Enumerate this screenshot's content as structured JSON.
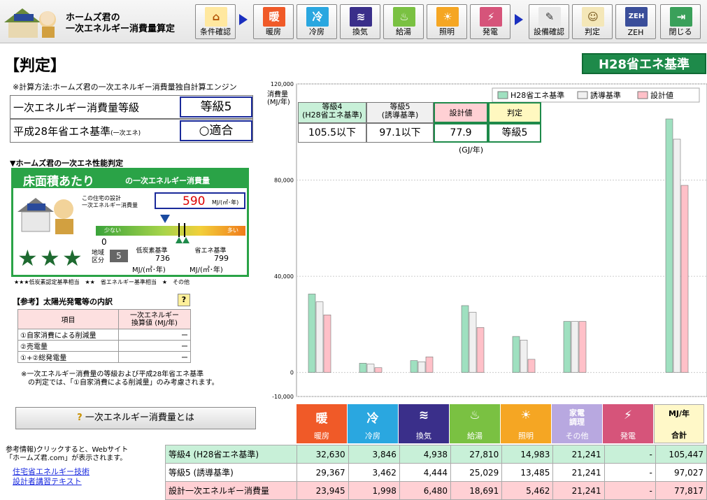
{
  "app": {
    "title_line1": "ホームズ君の",
    "title_line2": "一次エネルギー消費量算定"
  },
  "toolbar": [
    {
      "label": "条件確認",
      "glyph": "⌂",
      "color": "#ffe8a0",
      "fg": "#b05000"
    },
    {
      "label": "暖房",
      "glyph": "暖",
      "color": "#f05a28",
      "fg": "#fff"
    },
    {
      "label": "冷房",
      "glyph": "冷",
      "color": "#2aa7e0",
      "fg": "#fff"
    },
    {
      "label": "換気",
      "glyph": "≋",
      "color": "#3a2f8a",
      "fg": "#fff"
    },
    {
      "label": "給湯",
      "glyph": "♨",
      "color": "#7ac142",
      "fg": "#fff"
    },
    {
      "label": "照明",
      "glyph": "☀",
      "color": "#f5a623",
      "fg": "#fff"
    },
    {
      "label": "発電",
      "glyph": "⚡",
      "color": "#d6547a",
      "fg": "#fff"
    },
    {
      "label": "設備確認",
      "glyph": "✎",
      "color": "#e8e8e8",
      "fg": "#333"
    },
    {
      "label": "判定",
      "glyph": "☺",
      "color": "#f4e7b8",
      "fg": "#6a4a10"
    },
    {
      "label": "ZEH",
      "glyph": "ZEH",
      "color": "#3a4e9a",
      "fg": "#fff"
    },
    {
      "label": "閉じる",
      "glyph": "⇥",
      "color": "#3aa05a",
      "fg": "#fff"
    }
  ],
  "page": {
    "title": "【判定】",
    "standard_badge": "H28省エネ基準"
  },
  "calc_note": "※計算方法:ホームズ君の一次エネルギー消費量独自計算エンジン",
  "grade": {
    "label1": "一次エネルギー消費量等級",
    "value1": "等級5",
    "label2": "平成28年省エネ基準",
    "label2_small": "(一次エネ)",
    "value2": "○適合"
  },
  "perf": {
    "heading": "▼ホームズ君の一次エネ性能判定",
    "banner_main": "床面積あたり",
    "banner_sub": "の一次エネルギー消費量",
    "design_label": "この住宅の設計\n一次エネルギー消費量",
    "design_value": "590",
    "design_unit": "MJ/(㎡･年)",
    "bar_low": "少ない",
    "bar_high": "多い",
    "zero": "0",
    "region_label": "地域\n区分",
    "region_value": "5",
    "low_carbon_label": "低炭素基準",
    "low_carbon_value": "736",
    "saving_label": "省エネ基準",
    "saving_value": "799",
    "unit": "MJ/(㎡･年)",
    "star_legend": "★★★低炭素認定基準相当　★★　省エネルギー基準相当　★　その他"
  },
  "solar": {
    "heading": "【参考】太陽光発電等の内訳",
    "help": "?",
    "col_item": "項目",
    "col_value": "一次エネルギー\n換算値 (MJ/年)",
    "rows": [
      {
        "item": "①自家消費による削減量",
        "value": "ー"
      },
      {
        "item": "②売電量",
        "value": "ー"
      },
      {
        "item": "①+②総発電量",
        "value": "ー"
      }
    ],
    "note": "※一次エネルギー消費量の等級および平成28年省エネ基準\n　の判定では、「①自家消費による削減量」のみ考慮されます。"
  },
  "primary_button": "一次エネルギー消費量とは",
  "reference": {
    "text": "参考情報)クリックすると、Webサイト\n「ホームズ君.com」が表示されます。",
    "link1": "住宅省エネルギー技術",
    "link2": "設計者講習テキスト"
  },
  "summary": {
    "h1": "等級4\n(H28省エネ基準)",
    "v1": "105.5以下",
    "h2": "等級5\n(誘導基準)",
    "v2": "97.1以下",
    "h3": "設計値",
    "v3": "77.9",
    "h4": "判定",
    "v4": "等級5",
    "unit": "(GJ/年)"
  },
  "chart_data": {
    "type": "bar",
    "ylabel": "消費量\n(MJ/年)",
    "ylim": [
      -10000,
      120000
    ],
    "yticks": [
      "120,000",
      "80,000",
      "40,000",
      "0",
      "-10,000"
    ],
    "categories": [
      "暖房",
      "冷房",
      "換気",
      "給湯",
      "照明",
      "その他",
      "発電",
      "合計"
    ],
    "series": [
      {
        "name": "H28省エネ基準",
        "color": "#9fe0c0",
        "values": [
          32630,
          3846,
          4938,
          27810,
          14983,
          21241,
          0,
          105447
        ]
      },
      {
        "name": "誘導基準",
        "color": "#f0f0f0",
        "values": [
          29367,
          3462,
          4444,
          25029,
          13485,
          21241,
          0,
          97027
        ]
      },
      {
        "name": "設計値",
        "color": "#ffc0c8",
        "values": [
          23945,
          1998,
          6480,
          18691,
          5462,
          21241,
          0,
          77817
        ]
      }
    ],
    "legend": "top-right"
  },
  "categories_bar": [
    {
      "glyph": "暖",
      "label": "暖房",
      "color": "#f05a28"
    },
    {
      "glyph": "冷",
      "label": "冷房",
      "color": "#2aa7e0"
    },
    {
      "glyph": "≋",
      "label": "換気",
      "color": "#3a2f8a"
    },
    {
      "glyph": "♨",
      "label": "給湯",
      "color": "#7ac142"
    },
    {
      "glyph": "☀",
      "label": "照明",
      "color": "#f5a623"
    },
    {
      "glyph": "家電\n調理",
      "label": "その他",
      "color": "#b8a8e0"
    },
    {
      "glyph": "⚡",
      "label": "発電",
      "color": "#d6547a"
    },
    {
      "glyph": "MJ/年",
      "label": "合計",
      "color": "#fff8c8"
    }
  ],
  "data_rows": [
    {
      "label": "等級4 (H28省エネ基準)",
      "values": [
        "32,630",
        "3,846",
        "4,938",
        "27,810",
        "14,983",
        "21,241",
        "-",
        "105,447"
      ],
      "color": "#c8f0d8"
    },
    {
      "label": "等級5 (誘導基準)",
      "values": [
        "29,367",
        "3,462",
        "4,444",
        "25,029",
        "13,485",
        "21,241",
        "-",
        "97,027"
      ],
      "color": "#ffffff"
    },
    {
      "label": "設計一次エネルギー消費量",
      "values": [
        "23,945",
        "1,998",
        "6,480",
        "18,691",
        "5,462",
        "21,241",
        "-",
        "77,817"
      ],
      "color": "#ffd0d4"
    }
  ]
}
